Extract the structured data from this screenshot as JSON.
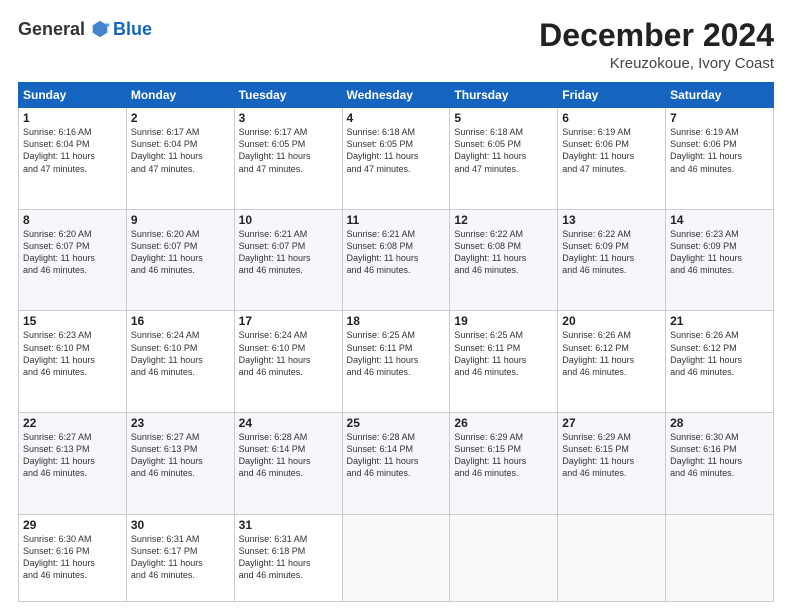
{
  "logo": {
    "general": "General",
    "blue": "Blue"
  },
  "header": {
    "month": "December 2024",
    "location": "Kreuzokoue, Ivory Coast"
  },
  "days_of_week": [
    "Sunday",
    "Monday",
    "Tuesday",
    "Wednesday",
    "Thursday",
    "Friday",
    "Saturday"
  ],
  "weeks": [
    [
      {
        "day": "1",
        "sunrise": "Sunrise: 6:16 AM",
        "sunset": "Sunset: 6:04 PM",
        "daylight": "Daylight: 11 hours and 47 minutes."
      },
      {
        "day": "2",
        "sunrise": "Sunrise: 6:17 AM",
        "sunset": "Sunset: 6:04 PM",
        "daylight": "Daylight: 11 hours and 47 minutes."
      },
      {
        "day": "3",
        "sunrise": "Sunrise: 6:17 AM",
        "sunset": "Sunset: 6:05 PM",
        "daylight": "Daylight: 11 hours and 47 minutes."
      },
      {
        "day": "4",
        "sunrise": "Sunrise: 6:18 AM",
        "sunset": "Sunset: 6:05 PM",
        "daylight": "Daylight: 11 hours and 47 minutes."
      },
      {
        "day": "5",
        "sunrise": "Sunrise: 6:18 AM",
        "sunset": "Sunset: 6:05 PM",
        "daylight": "Daylight: 11 hours and 47 minutes."
      },
      {
        "day": "6",
        "sunrise": "Sunrise: 6:19 AM",
        "sunset": "Sunset: 6:06 PM",
        "daylight": "Daylight: 11 hours and 47 minutes."
      },
      {
        "day": "7",
        "sunrise": "Sunrise: 6:19 AM",
        "sunset": "Sunset: 6:06 PM",
        "daylight": "Daylight: 11 hours and 46 minutes."
      }
    ],
    [
      {
        "day": "8",
        "sunrise": "Sunrise: 6:20 AM",
        "sunset": "Sunset: 6:07 PM",
        "daylight": "Daylight: 11 hours and 46 minutes."
      },
      {
        "day": "9",
        "sunrise": "Sunrise: 6:20 AM",
        "sunset": "Sunset: 6:07 PM",
        "daylight": "Daylight: 11 hours and 46 minutes."
      },
      {
        "day": "10",
        "sunrise": "Sunrise: 6:21 AM",
        "sunset": "Sunset: 6:07 PM",
        "daylight": "Daylight: 11 hours and 46 minutes."
      },
      {
        "day": "11",
        "sunrise": "Sunrise: 6:21 AM",
        "sunset": "Sunset: 6:08 PM",
        "daylight": "Daylight: 11 hours and 46 minutes."
      },
      {
        "day": "12",
        "sunrise": "Sunrise: 6:22 AM",
        "sunset": "Sunset: 6:08 PM",
        "daylight": "Daylight: 11 hours and 46 minutes."
      },
      {
        "day": "13",
        "sunrise": "Sunrise: 6:22 AM",
        "sunset": "Sunset: 6:09 PM",
        "daylight": "Daylight: 11 hours and 46 minutes."
      },
      {
        "day": "14",
        "sunrise": "Sunrise: 6:23 AM",
        "sunset": "Sunset: 6:09 PM",
        "daylight": "Daylight: 11 hours and 46 minutes."
      }
    ],
    [
      {
        "day": "15",
        "sunrise": "Sunrise: 6:23 AM",
        "sunset": "Sunset: 6:10 PM",
        "daylight": "Daylight: 11 hours and 46 minutes."
      },
      {
        "day": "16",
        "sunrise": "Sunrise: 6:24 AM",
        "sunset": "Sunset: 6:10 PM",
        "daylight": "Daylight: 11 hours and 46 minutes."
      },
      {
        "day": "17",
        "sunrise": "Sunrise: 6:24 AM",
        "sunset": "Sunset: 6:10 PM",
        "daylight": "Daylight: 11 hours and 46 minutes."
      },
      {
        "day": "18",
        "sunrise": "Sunrise: 6:25 AM",
        "sunset": "Sunset: 6:11 PM",
        "daylight": "Daylight: 11 hours and 46 minutes."
      },
      {
        "day": "19",
        "sunrise": "Sunrise: 6:25 AM",
        "sunset": "Sunset: 6:11 PM",
        "daylight": "Daylight: 11 hours and 46 minutes."
      },
      {
        "day": "20",
        "sunrise": "Sunrise: 6:26 AM",
        "sunset": "Sunset: 6:12 PM",
        "daylight": "Daylight: 11 hours and 46 minutes."
      },
      {
        "day": "21",
        "sunrise": "Sunrise: 6:26 AM",
        "sunset": "Sunset: 6:12 PM",
        "daylight": "Daylight: 11 hours and 46 minutes."
      }
    ],
    [
      {
        "day": "22",
        "sunrise": "Sunrise: 6:27 AM",
        "sunset": "Sunset: 6:13 PM",
        "daylight": "Daylight: 11 hours and 46 minutes."
      },
      {
        "day": "23",
        "sunrise": "Sunrise: 6:27 AM",
        "sunset": "Sunset: 6:13 PM",
        "daylight": "Daylight: 11 hours and 46 minutes."
      },
      {
        "day": "24",
        "sunrise": "Sunrise: 6:28 AM",
        "sunset": "Sunset: 6:14 PM",
        "daylight": "Daylight: 11 hours and 46 minutes."
      },
      {
        "day": "25",
        "sunrise": "Sunrise: 6:28 AM",
        "sunset": "Sunset: 6:14 PM",
        "daylight": "Daylight: 11 hours and 46 minutes."
      },
      {
        "day": "26",
        "sunrise": "Sunrise: 6:29 AM",
        "sunset": "Sunset: 6:15 PM",
        "daylight": "Daylight: 11 hours and 46 minutes."
      },
      {
        "day": "27",
        "sunrise": "Sunrise: 6:29 AM",
        "sunset": "Sunset: 6:15 PM",
        "daylight": "Daylight: 11 hours and 46 minutes."
      },
      {
        "day": "28",
        "sunrise": "Sunrise: 6:30 AM",
        "sunset": "Sunset: 6:16 PM",
        "daylight": "Daylight: 11 hours and 46 minutes."
      }
    ],
    [
      {
        "day": "29",
        "sunrise": "Sunrise: 6:30 AM",
        "sunset": "Sunset: 6:16 PM",
        "daylight": "Daylight: 11 hours and 46 minutes."
      },
      {
        "day": "30",
        "sunrise": "Sunrise: 6:31 AM",
        "sunset": "Sunset: 6:17 PM",
        "daylight": "Daylight: 11 hours and 46 minutes."
      },
      {
        "day": "31",
        "sunrise": "Sunrise: 6:31 AM",
        "sunset": "Sunset: 6:18 PM",
        "daylight": "Daylight: 11 hours and 46 minutes."
      },
      null,
      null,
      null,
      null
    ]
  ]
}
